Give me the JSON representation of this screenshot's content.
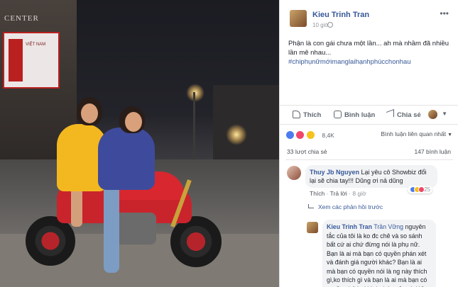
{
  "photo": {
    "building_text": "CENTER",
    "sign_text": "VIỆT NAM"
  },
  "post": {
    "author": "Kieu Trinh Tran",
    "time": "10 giờ",
    "text": "Phận là con gái chưa một lần... ah mà nhầm đã nhiều lần mê nhau...",
    "hashtag": "#chiphụnữmớimanglaihạnhphúcchonhau"
  },
  "actions": {
    "like": "Thích",
    "comment": "Bình luận",
    "share": "Chia sẻ"
  },
  "stats": {
    "reaction_count": "8,4K",
    "comment_filter": "Bình luận liên quan nhất",
    "shares": "33 lượt chia sẻ",
    "comments": "147 bình luận"
  },
  "comments": [
    {
      "author": "Thuy Jb Nguyen",
      "text": "Lại yêu cô Showbiz đổi lại sẽ chia tay!!! Dũng ơi nả dũng",
      "like": "Thích",
      "reply": "Trả lời",
      "time": "8 giờ",
      "reaction_count": "25"
    },
    {
      "author": "Kieu Trinh Tran",
      "mention": "Trần Vững",
      "text": "nguyên tắc của tôi là ko đc chê và so sánh bất cứ ai chứ đừng nói là phụ nữ. Bạn là ai mà bạn có quyền phán xét và đánh giá người khác? Bạn là ai mà bạn có quyền nói là ng này thích gì,ko thích gì và bạn là ai mà bạn có quyền chê bai hình thức của ai đó?"
    }
  ],
  "more_replies": "Xem các phản hồi trước",
  "colors": {
    "link": "#365899",
    "like_reaction": "#4c7bf0",
    "love_reaction": "#f0466a",
    "haha_reaction": "#f7c21d"
  }
}
